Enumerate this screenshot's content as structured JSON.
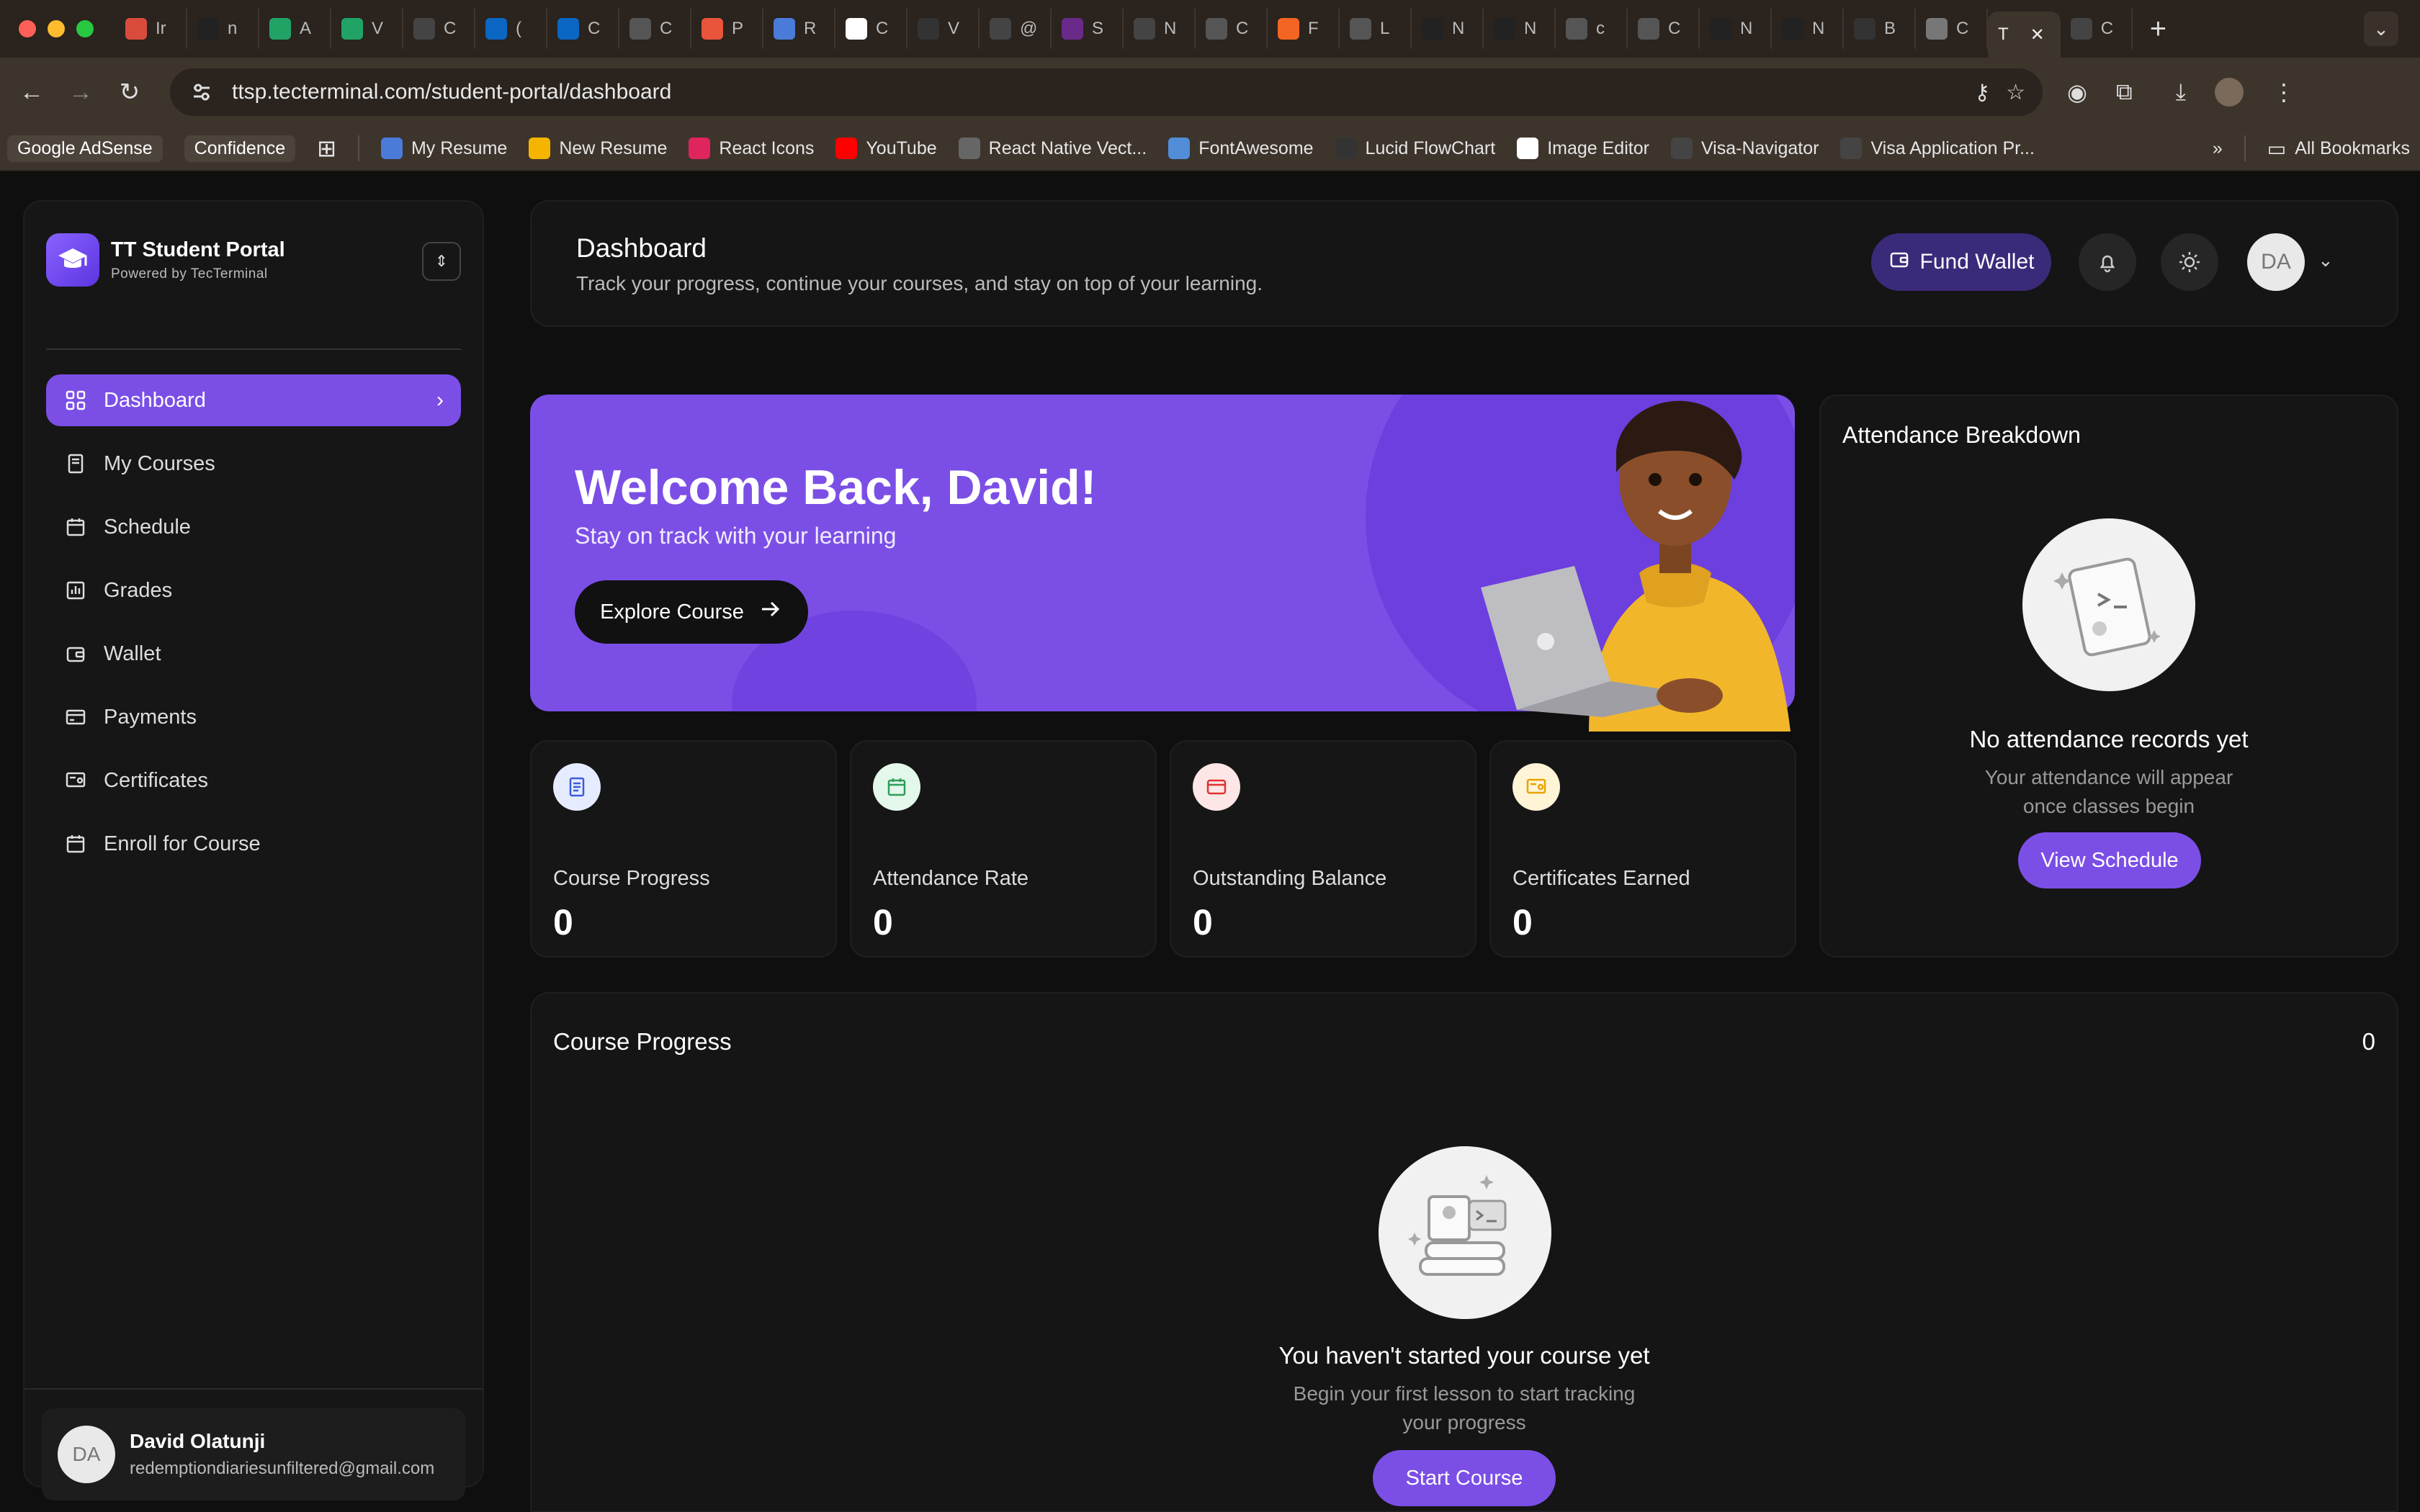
{
  "browser": {
    "tabs": [
      {
        "letter": "Ir",
        "color": "#d94c3d",
        "icon": "gmail-icon"
      },
      {
        "letter": "n",
        "color": "#222222",
        "icon": "m-icon"
      },
      {
        "letter": "A",
        "color": "#21a366",
        "icon": "sheets-icon"
      },
      {
        "letter": "V",
        "color": "#21a366",
        "icon": "sheets-icon"
      },
      {
        "letter": "C",
        "color": "#444444",
        "icon": "github-icon"
      },
      {
        "letter": "(",
        "color": "#0a66c2",
        "icon": "linkedin-icon"
      },
      {
        "letter": "C",
        "color": "#0a66c2",
        "icon": "linkedin-icon"
      },
      {
        "letter": "C",
        "color": "#555555",
        "icon": "openai-icon"
      },
      {
        "letter": "P",
        "color": "#e8553b",
        "icon": "app-icon"
      },
      {
        "letter": "R",
        "color": "#4a7bd9",
        "icon": "docs-icon"
      },
      {
        "letter": "C",
        "color": "#ffffff",
        "icon": "w-icon"
      },
      {
        "letter": "V",
        "color": "#333333",
        "icon": "bird-icon"
      },
      {
        "letter": "@",
        "color": "#444444",
        "icon": "paw-icon"
      },
      {
        "letter": "S",
        "color": "#6a2a8a",
        "icon": "s-icon"
      },
      {
        "letter": "N",
        "color": "#444444",
        "icon": "github-icon"
      },
      {
        "letter": "C",
        "color": "#555555",
        "icon": "openai-icon"
      },
      {
        "letter": "F",
        "color": "#f26522",
        "icon": "ycombinator-icon"
      },
      {
        "letter": "L",
        "color": "#555555",
        "icon": "globe-icon"
      },
      {
        "letter": "N",
        "color": "#222222",
        "icon": "m-icon"
      },
      {
        "letter": "N",
        "color": "#222222",
        "icon": "m-icon"
      },
      {
        "letter": "c",
        "color": "#555555",
        "icon": "globe-icon"
      },
      {
        "letter": "C",
        "color": "#555555",
        "icon": "globe-icon"
      },
      {
        "letter": "N",
        "color": "#222222",
        "icon": "m-icon"
      },
      {
        "letter": "N",
        "color": "#222222",
        "icon": "m-icon"
      },
      {
        "letter": "B",
        "color": "#333333",
        "icon": "app-icon"
      },
      {
        "letter": "C",
        "color": "#777777",
        "icon": "image-icon"
      }
    ],
    "active_tab": {
      "letter": "T",
      "close": "✕"
    },
    "last_tab": {
      "letter": "C",
      "icon": "github-icon"
    },
    "url": "ttsp.tecterminal.com/student-portal/dashboard",
    "bookmarks": [
      {
        "label": "Google AdSense",
        "pill": true
      },
      {
        "label": "Confidence",
        "pill": true
      },
      {
        "label": "My Resume",
        "color": "#4a7bd9",
        "icon": "docs-icon"
      },
      {
        "label": "New Resume",
        "color": "#f4b400",
        "icon": "drive-icon"
      },
      {
        "label": "React Icons",
        "color": "#e0245e",
        "icon": "react-icon"
      },
      {
        "label": "YouTube",
        "color": "#ff0000",
        "icon": "youtube-icon"
      },
      {
        "label": "React Native Vect...",
        "color": "#666666",
        "icon": "globe-icon"
      },
      {
        "label": "FontAwesome",
        "color": "#528dd7",
        "icon": "flag-icon"
      },
      {
        "label": "Lucid FlowChart",
        "color": "#333333",
        "icon": "lucid-icon"
      },
      {
        "label": "Image Editor",
        "color": "#ffffff",
        "icon": "image-editor-icon"
      },
      {
        "label": "Visa-Navigator",
        "color": "#444444",
        "icon": "visa-icon"
      },
      {
        "label": "Visa Application Pr...",
        "color": "#444444",
        "icon": "visa-icon"
      }
    ],
    "all_bookmarks": "All Bookmarks"
  },
  "sidebar": {
    "brand_title": "TT Student Portal",
    "brand_sub": "Powered by TecTerminal",
    "items": [
      {
        "label": "Dashboard",
        "icon": "grid-icon",
        "active": true
      },
      {
        "label": "My Courses",
        "icon": "book-icon"
      },
      {
        "label": "Schedule",
        "icon": "calendar-icon"
      },
      {
        "label": "Grades",
        "icon": "bar-chart-icon"
      },
      {
        "label": "Wallet",
        "icon": "wallet-icon"
      },
      {
        "label": "Payments",
        "icon": "credit-card-icon"
      },
      {
        "label": "Certificates",
        "icon": "certificate-icon"
      },
      {
        "label": "Enroll for Course",
        "icon": "calendar-plus-icon"
      }
    ],
    "user": {
      "initials": "DA",
      "name": "David Olatunji",
      "email": "redemptiondiariesunfiltered@gmail.com"
    }
  },
  "header": {
    "title": "Dashboard",
    "subtitle": "Track your progress, continue your courses, and stay on top of your learning.",
    "fund_label": "Fund Wallet",
    "avatar": "DA"
  },
  "banner": {
    "heading": "Welcome Back, David!",
    "sub": "Stay on track with your learning",
    "cta": "Explore Course"
  },
  "stats": [
    {
      "label": "Course Progress",
      "value": "0",
      "bg": "#e6ecff",
      "fg": "#3b5bdb",
      "icon": "document-icon"
    },
    {
      "label": "Attendance Rate",
      "value": "0",
      "bg": "#e3f7ea",
      "fg": "#2f9e5b",
      "icon": "calendar-icon"
    },
    {
      "label": "Outstanding Balance",
      "value": "0",
      "bg": "#ffe6e6",
      "fg": "#e03131",
      "icon": "card-icon"
    },
    {
      "label": "Certificates Earned",
      "value": "0",
      "bg": "#fff4d6",
      "fg": "#e8a400",
      "icon": "certificate-icon"
    }
  ],
  "attendance": {
    "title": "Attendance Breakdown",
    "empty_title": "No attendance records yet",
    "empty_line1": "Your attendance will appear",
    "empty_line2": "once classes begin",
    "cta": "View Schedule"
  },
  "progress": {
    "title": "Course Progress",
    "count": "0",
    "empty_title": "You haven't started your course yet",
    "empty_line1": "Begin your first lesson to start tracking",
    "empty_line2": "your progress",
    "cta": "Start Course"
  },
  "colors": {
    "accent": "#7b4fe6",
    "panel": "#151515",
    "background": "#0f0f0f"
  }
}
